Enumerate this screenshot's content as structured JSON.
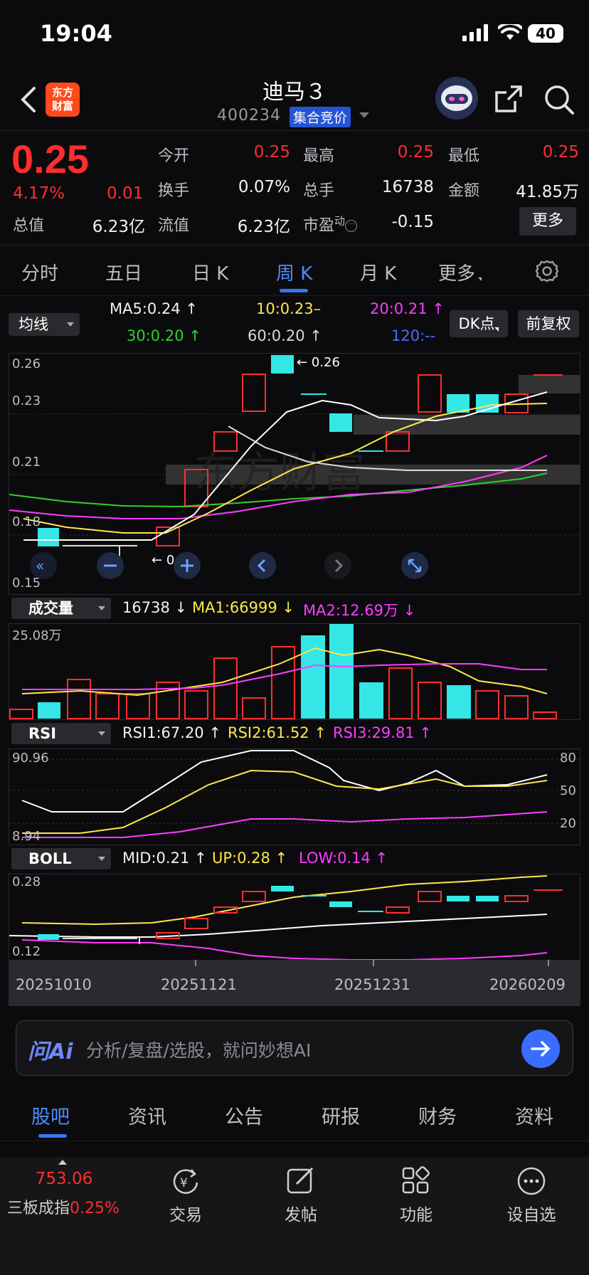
{
  "status_bar": {
    "time": "19:04",
    "battery": "40"
  },
  "header": {
    "logo_line1": "东方",
    "logo_line2": "财富",
    "stock_name": "迪马３",
    "stock_code": "400234",
    "phase": "集合竞价"
  },
  "quote": {
    "price": "0.25",
    "change_pct": "4.17%",
    "change": "0.01",
    "fields": [
      {
        "label": "今开",
        "value": "0.25",
        "color": "#ff2e2e"
      },
      {
        "label": "最高",
        "value": "0.25",
        "color": "#ff2e2e"
      },
      {
        "label": "最低",
        "value": "0.25",
        "color": "#ff2e2e"
      },
      {
        "label": "换手",
        "value": "0.07%",
        "color": "#f2f2f2"
      },
      {
        "label": "总手",
        "value": "16738",
        "color": "#f2f2f2"
      },
      {
        "label": "金额",
        "value": "41.85万",
        "color": "#f2f2f2"
      },
      {
        "label": "总值",
        "value": "6.23亿",
        "color": "#f2f2f2"
      },
      {
        "label": "流值",
        "value": "6.23亿",
        "color": "#f2f2f2"
      },
      {
        "label": "市盈",
        "value": "-0.15",
        "color": "#f2f2f2"
      }
    ],
    "pe_superscript": "动",
    "more": "更多"
  },
  "period_tabs": [
    {
      "label": "分时",
      "active": false
    },
    {
      "label": "五日",
      "active": false
    },
    {
      "label": "日 K",
      "active": false
    },
    {
      "label": "周 K",
      "active": true
    },
    {
      "label": "月 K",
      "active": false
    },
    {
      "label": "更多",
      "active": false
    }
  ],
  "ma_row": {
    "selector": "均线",
    "ma5": "MA5:0.24",
    "ma10": "10:0.23",
    "ma20": "20:0.21",
    "ma30": "30:0.20",
    "ma60": "60:0.20",
    "ma120": "120:--",
    "dk_btn": "DK点",
    "adj_btn": "前复权"
  },
  "kline": {
    "y_labels": [
      "0.26",
      "0.23",
      "0.21",
      "0.18",
      "0.15"
    ],
    "high_marker": "0.26",
    "low_marker": "0.15",
    "watermark": "东方财富"
  },
  "volume": {
    "selector": "成交量",
    "vol": "16738",
    "ma1": "MA1:66999",
    "ma2": "MA2:12.69万",
    "max_label": "25.08万"
  },
  "rsi": {
    "selector": "RSI",
    "rsi1": "RSI1:67.20",
    "rsi2": "RSI2:61.52",
    "rsi3": "RSI3:29.81",
    "top": "90.96",
    "bottom": "8.94",
    "levels": [
      "80",
      "50",
      "20"
    ]
  },
  "boll": {
    "selector": "BOLL",
    "mid": "MID:0.21",
    "up": "UP:0.28",
    "low": "LOW:0.14",
    "top": "0.28",
    "bottom": "0.12"
  },
  "dates": [
    "20251010",
    "20251121",
    "20251231",
    "20260209"
  ],
  "ai": {
    "logo": "问Ai",
    "placeholder": "分析/复盘/选股，就问妙想AI"
  },
  "sections": [
    {
      "label": "股吧",
      "active": true
    },
    {
      "label": "资讯",
      "active": false
    },
    {
      "label": "公告",
      "active": false
    },
    {
      "label": "研报",
      "active": false
    },
    {
      "label": "财务",
      "active": false
    },
    {
      "label": "资料",
      "active": false
    }
  ],
  "bottom_nav": {
    "index_value": "753.06",
    "index_name": "三板成指",
    "index_pct": "0.25%",
    "items": [
      "交易",
      "发帖",
      "功能",
      "设自选"
    ]
  }
}
